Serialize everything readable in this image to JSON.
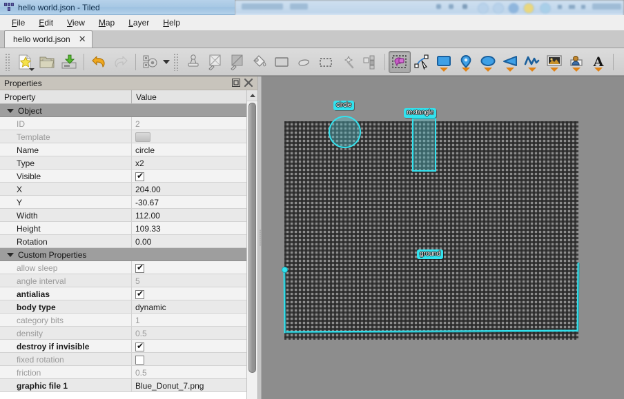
{
  "window": {
    "title": "hello world.json - Tiled",
    "logo_icon": "tiled-logo-icon"
  },
  "menubar": {
    "items": [
      {
        "label": "File",
        "mnemonic": "F"
      },
      {
        "label": "Edit",
        "mnemonic": "E"
      },
      {
        "label": "View",
        "mnemonic": "V"
      },
      {
        "label": "Map",
        "mnemonic": "M"
      },
      {
        "label": "Layer",
        "mnemonic": "L"
      },
      {
        "label": "Help",
        "mnemonic": "H"
      }
    ]
  },
  "tabs": [
    {
      "label": "hello world.json",
      "close_label": "✕",
      "active": true
    }
  ],
  "toolbar": {
    "groups": [
      {
        "buttons": [
          {
            "name": "new-map-icon",
            "tooltip": "New Map",
            "state": "normal",
            "has_dropdown": true
          },
          {
            "name": "open-file-icon",
            "tooltip": "Open",
            "state": "normal",
            "has_dropdown": false
          },
          {
            "name": "save-file-icon",
            "tooltip": "Save",
            "state": "normal",
            "has_dropdown": false
          }
        ]
      },
      {
        "buttons": [
          {
            "name": "undo-icon",
            "tooltip": "Undo",
            "state": "normal",
            "has_dropdown": false
          },
          {
            "name": "redo-icon",
            "tooltip": "Redo",
            "state": "disabled",
            "has_dropdown": false
          }
        ]
      },
      {
        "buttons": [
          {
            "name": "map-properties-icon",
            "tooltip": "Map Properties",
            "state": "normal",
            "has_dropdown": true
          }
        ]
      },
      {
        "buttons": [
          {
            "name": "stamp-brush-icon",
            "tooltip": "Stamp Brush",
            "state": "normal",
            "has_dropdown": false
          },
          {
            "name": "terrain-brush-icon",
            "tooltip": "Terrain Brush",
            "state": "normal",
            "has_dropdown": false
          },
          {
            "name": "shape-fill-icon",
            "tooltip": "Shape Fill",
            "state": "normal",
            "has_dropdown": false
          },
          {
            "name": "bucket-fill-icon",
            "tooltip": "Bucket Fill",
            "state": "normal",
            "has_dropdown": false
          },
          {
            "name": "rectangle-icon",
            "tooltip": "Rectangle",
            "state": "normal",
            "has_dropdown": false
          },
          {
            "name": "eraser-icon",
            "tooltip": "Eraser",
            "state": "normal",
            "has_dropdown": false
          },
          {
            "name": "rectangular-select-icon",
            "tooltip": "Rectangular Select",
            "state": "normal",
            "has_dropdown": false
          },
          {
            "name": "magic-wand-icon",
            "tooltip": "Magic Wand",
            "state": "normal",
            "has_dropdown": false
          },
          {
            "name": "select-same-tile-icon",
            "tooltip": "Select Same Tile",
            "state": "normal",
            "has_dropdown": false
          }
        ]
      },
      {
        "buttons": [
          {
            "name": "select-objects-icon",
            "tooltip": "Select Objects",
            "state": "pressed",
            "has_dropdown": false
          },
          {
            "name": "edit-polygons-icon",
            "tooltip": "Edit Polygons",
            "state": "normal",
            "has_dropdown": false
          },
          {
            "name": "insert-rectangle-icon",
            "tooltip": "Insert Rectangle",
            "state": "normal",
            "has_dropdown": true
          },
          {
            "name": "insert-point-icon",
            "tooltip": "Insert Point",
            "state": "normal",
            "has_dropdown": true
          },
          {
            "name": "insert-ellipse-icon",
            "tooltip": "Insert Ellipse",
            "state": "normal",
            "has_dropdown": true
          },
          {
            "name": "insert-polygon-icon",
            "tooltip": "Insert Polygon",
            "state": "normal",
            "has_dropdown": true
          },
          {
            "name": "insert-polyline-icon",
            "tooltip": "Insert Polyline",
            "state": "normal",
            "has_dropdown": true
          },
          {
            "name": "insert-tile-icon",
            "tooltip": "Insert Tile",
            "state": "normal",
            "has_dropdown": true
          },
          {
            "name": "insert-template-icon",
            "tooltip": "Insert Template",
            "state": "normal",
            "has_dropdown": true
          },
          {
            "name": "insert-text-icon",
            "tooltip": "Insert Text",
            "state": "normal",
            "has_dropdown": true
          }
        ]
      }
    ]
  },
  "properties_dock": {
    "title": "Properties",
    "float_icon": "undock-icon",
    "close_icon": "close-icon",
    "columns": {
      "property": "Property",
      "value": "Value"
    },
    "groups": [
      {
        "name": "Object",
        "expanded": true,
        "rows": [
          {
            "label": "ID",
            "type": "text",
            "value": "2",
            "dim": true,
            "bold": false
          },
          {
            "label": "Template",
            "type": "template",
            "value": "",
            "dim": true,
            "bold": false
          },
          {
            "label": "Name",
            "type": "text",
            "value": "circle",
            "dim": false,
            "bold": false
          },
          {
            "label": "Type",
            "type": "text",
            "value": "x2",
            "dim": false,
            "bold": false
          },
          {
            "label": "Visible",
            "type": "checkbox",
            "value": true,
            "dim": false,
            "bold": false
          },
          {
            "label": "X",
            "type": "text",
            "value": "204.00",
            "dim": false,
            "bold": false
          },
          {
            "label": "Y",
            "type": "text",
            "value": "-30.67",
            "dim": false,
            "bold": false
          },
          {
            "label": "Width",
            "type": "text",
            "value": "112.00",
            "dim": false,
            "bold": false
          },
          {
            "label": "Height",
            "type": "text",
            "value": "109.33",
            "dim": false,
            "bold": false
          },
          {
            "label": "Rotation",
            "type": "text",
            "value": "0.00",
            "dim": false,
            "bold": false
          }
        ]
      },
      {
        "name": "Custom Properties",
        "expanded": true,
        "rows": [
          {
            "label": "allow sleep",
            "type": "checkbox",
            "value": true,
            "dim": true,
            "bold": false
          },
          {
            "label": "angle interval",
            "type": "text",
            "value": "5",
            "dim": true,
            "bold": false
          },
          {
            "label": "antialias",
            "type": "checkbox",
            "value": true,
            "dim": false,
            "bold": true
          },
          {
            "label": "body type",
            "type": "text",
            "value": "dynamic",
            "dim": false,
            "bold": true
          },
          {
            "label": "category bits",
            "type": "text",
            "value": "1",
            "dim": true,
            "bold": false
          },
          {
            "label": "density",
            "type": "text",
            "value": "0.5",
            "dim": true,
            "bold": false
          },
          {
            "label": "destroy if invisible",
            "type": "checkbox",
            "value": true,
            "dim": false,
            "bold": true
          },
          {
            "label": "fixed rotation",
            "type": "checkbox",
            "value": false,
            "dim": true,
            "bold": false
          },
          {
            "label": "friction",
            "type": "text",
            "value": "0.5",
            "dim": true,
            "bold": false
          },
          {
            "label": "graphic file 1",
            "type": "text",
            "value": "Blue_Donut_7.png",
            "dim": false,
            "bold": true
          }
        ]
      }
    ],
    "scrollbar": {
      "up_arrow": "scroll-up-icon",
      "down_arrow": "scroll-down-icon"
    }
  },
  "canvas": {
    "background_color": "#8d8d8d",
    "grid_color": "#282828",
    "object_color": "#32e2ee",
    "objects": [
      {
        "name": "circle",
        "shape": "ellipse",
        "label": "circle"
      },
      {
        "name": "rectangle",
        "shape": "rectangle",
        "label": "rectangle"
      },
      {
        "name": "ground",
        "shape": "polyline",
        "label": "ground"
      }
    ]
  }
}
